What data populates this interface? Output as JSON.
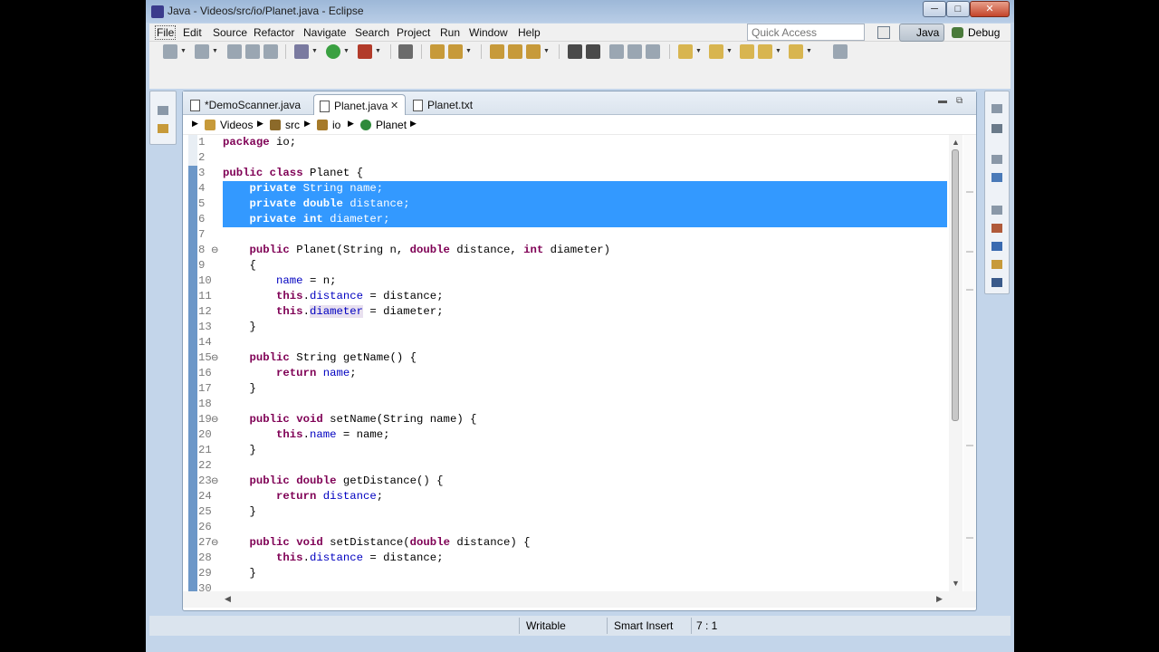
{
  "window": {
    "title": "Java - Videos/src/io/Planet.java - Eclipse",
    "minimize_glyph": "─",
    "maximize_glyph": "□",
    "close_glyph": "✕"
  },
  "menu": [
    "File",
    "Edit",
    "Source",
    "Refactor",
    "Navigate",
    "Search",
    "Project",
    "Run",
    "Window",
    "Help"
  ],
  "quick_access": {
    "placeholder": "Quick Access"
  },
  "perspectives": {
    "java": "Java",
    "debug": "Debug"
  },
  "tabs": [
    {
      "label": "*DemoScanner.java",
      "active": false
    },
    {
      "label": "Planet.java",
      "active": true
    },
    {
      "label": "Planet.txt",
      "active": false
    }
  ],
  "tab_close_glyph": "✕",
  "breadcrumb": [
    "Videos",
    "src",
    "io",
    "Planet"
  ],
  "code": {
    "line_numbers": [
      "1",
      "2",
      "3",
      "4",
      "5",
      "6",
      "7",
      "8",
      "9",
      "10",
      "11",
      "12",
      "13",
      "14",
      "15",
      "16",
      "17",
      "18",
      "19",
      "20",
      "21",
      "22",
      "23",
      "24",
      "25",
      "26",
      "27",
      "28",
      "29",
      "30"
    ],
    "fold_glyph": "⊖"
  },
  "status": {
    "mode": "Writable",
    "insert": "Smart Insert",
    "position": "7 : 1"
  },
  "colors": {
    "keyword": "#7f0055",
    "field": "#0000c0",
    "selection": "#3399ff",
    "line_number": "#7a7a7a"
  }
}
